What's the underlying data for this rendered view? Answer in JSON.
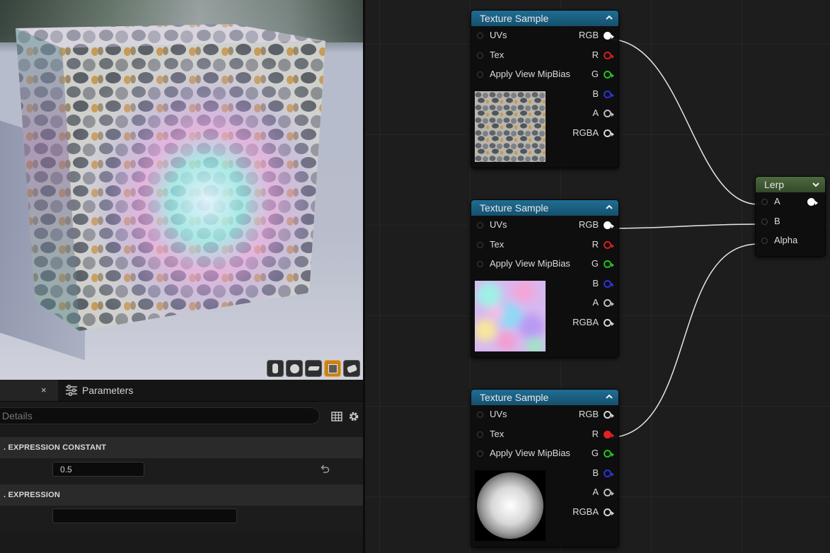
{
  "viewport": {
    "toolbar": [
      {
        "name": "cylinder",
        "active": false
      },
      {
        "name": "sphere",
        "active": false
      },
      {
        "name": "plane",
        "active": false
      },
      {
        "name": "cube",
        "active": true
      },
      {
        "name": "custom-mesh",
        "active": false
      }
    ]
  },
  "details_panel": {
    "tab_close": "×",
    "params_tab_label": "Parameters",
    "search_placeholder": "Details",
    "section1_title": ". EXPRESSION CONSTANT",
    "constant_value": "0.5",
    "section2_title": ". EXPRESSION",
    "expression_value": ""
  },
  "nodes": [
    {
      "title": "Texture Sample",
      "inputs": [
        "UVs",
        "Tex",
        "Apply View MipBias"
      ],
      "outputs": [
        {
          "label": "RGB",
          "color": "#ffffff",
          "filled": true
        },
        {
          "label": "R",
          "color": "#d41f1f",
          "filled": false
        },
        {
          "label": "G",
          "color": "#22c322",
          "filled": false
        },
        {
          "label": "B",
          "color": "#2b34d8",
          "filled": false
        },
        {
          "label": "A",
          "color": "#bdbdbd",
          "filled": false
        },
        {
          "label": "RGBA",
          "color": "#d6d6d6",
          "filled": false
        }
      ],
      "preview": "cobblestone-texture"
    },
    {
      "title": "Texture Sample",
      "inputs": [
        "UVs",
        "Tex",
        "Apply View MipBias"
      ],
      "outputs": [
        {
          "label": "RGB",
          "color": "#ffffff",
          "filled": true
        },
        {
          "label": "R",
          "color": "#d41f1f",
          "filled": false
        },
        {
          "label": "G",
          "color": "#22c322",
          "filled": false
        },
        {
          "label": "B",
          "color": "#2b34d8",
          "filled": false
        },
        {
          "label": "A",
          "color": "#bdbdbd",
          "filled": false
        },
        {
          "label": "RGBA",
          "color": "#d6d6d6",
          "filled": false
        }
      ],
      "preview": "rainbow-noise-texture"
    },
    {
      "title": "Texture Sample",
      "inputs": [
        "UVs",
        "Tex",
        "Apply View MipBias"
      ],
      "outputs": [
        {
          "label": "RGB",
          "color": "#d6d6d6",
          "filled": false
        },
        {
          "label": "R",
          "color": "#e22222",
          "filled": true
        },
        {
          "label": "G",
          "color": "#22c322",
          "filled": false
        },
        {
          "label": "B",
          "color": "#2b34d8",
          "filled": false
        },
        {
          "label": "A",
          "color": "#bdbdbd",
          "filled": false
        },
        {
          "label": "RGBA",
          "color": "#d6d6d6",
          "filled": false
        }
      ],
      "preview": "radial-gradient-mask"
    }
  ],
  "lerp": {
    "title": "Lerp",
    "inputs": [
      "A",
      "B",
      "Alpha"
    ]
  },
  "colors": {
    "node_header": "#1f6d94",
    "lerp_header": "#4d6a3e",
    "active_button": "#c7831a"
  }
}
